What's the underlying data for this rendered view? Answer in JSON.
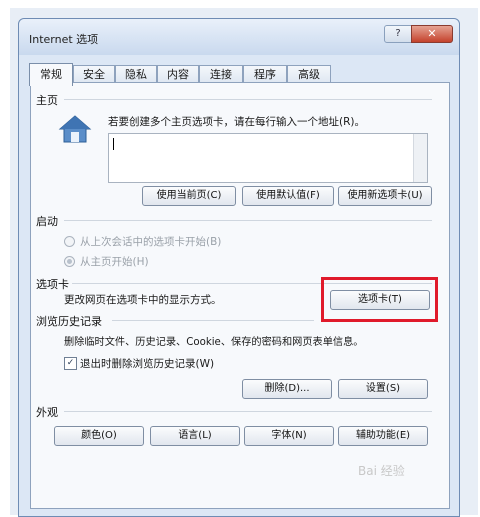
{
  "window": {
    "title": "Internet 选项",
    "help_label": "?",
    "close_label": "✕"
  },
  "tabs": [
    "常规",
    "安全",
    "隐私",
    "内容",
    "连接",
    "程序",
    "高级"
  ],
  "home": {
    "section_title": "主页",
    "description": "若要创建多个主页选项卡，请在每行输入一个地址(R)。",
    "btn_current": "使用当前页(C)",
    "btn_default": "使用默认值(F)",
    "btn_new_tab": "使用新选项卡(U)"
  },
  "startup": {
    "section_title": "启动",
    "option_last_session": "从上次会话中的选项卡开始(B)",
    "option_home_page": "从主页开始(H)"
  },
  "tabs_section": {
    "section_title": "选项卡",
    "description": "更改网页在选项卡中的显示方式。",
    "btn_tabs": "选项卡(T)"
  },
  "history": {
    "section_title": "浏览历史记录",
    "description": "删除临时文件、历史记录、Cookie、保存的密码和网页表单信息。",
    "checkbox_label": "退出时删除浏览历史记录(W)",
    "btn_delete": "删除(D)...",
    "btn_settings": "设置(S)"
  },
  "appearance": {
    "section_title": "外观",
    "btn_colors": "颜色(O)",
    "btn_languages": "语言(L)",
    "btn_fonts": "字体(N)",
    "btn_accessibility": "辅助功能(E)"
  },
  "watermark": "Bai 经验",
  "colors": {
    "highlight": "#e01a2b",
    "window_frame": "#dce7f5",
    "panel": "#f7f9fc"
  }
}
